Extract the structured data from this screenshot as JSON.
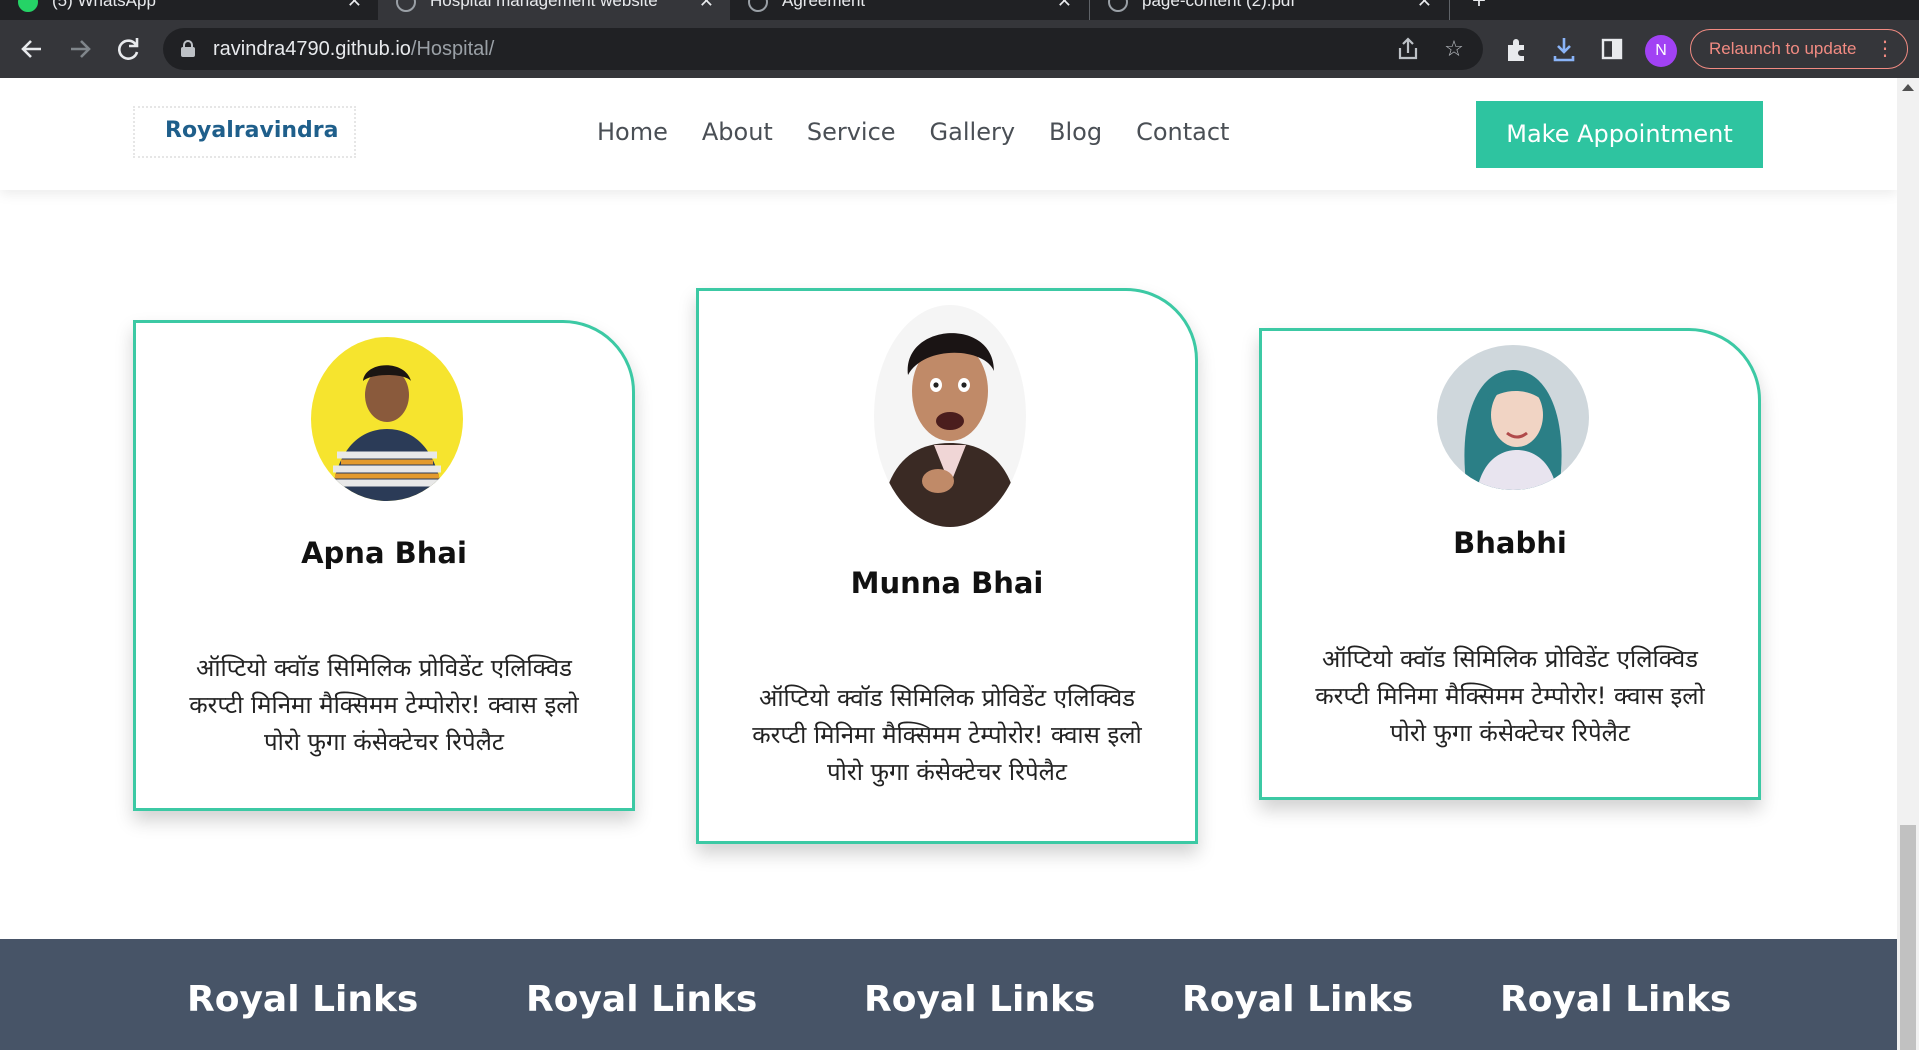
{
  "browser": {
    "tabs": [
      {
        "title": "(5) WhatsApp",
        "favicon": "whatsapp-icon"
      },
      {
        "title": "Hospital management website",
        "favicon": "globe-icon",
        "active": true
      },
      {
        "title": "Agreement",
        "favicon": "globe-icon"
      },
      {
        "title": "page-content (2).pdf",
        "favicon": "globe-icon"
      }
    ],
    "tab_close": "✕",
    "new_tab": "+",
    "url_host": "ravindra4790.github.io",
    "url_path": "/Hospital/",
    "profile_initial": "N",
    "relaunch_label": "Relaunch to update"
  },
  "site": {
    "logo": "Royalravindra",
    "nav": [
      "Home",
      "About",
      "Service",
      "Gallery",
      "Blog",
      "Contact"
    ],
    "cta": "Make Appointment"
  },
  "cards": [
    {
      "name": "Apna Bhai",
      "text": "ऑप्टियो क्वॉड सिमिलिक प्रोविडेंट एलिक्विड करप्टी मिनिमा मैक्सिमम टेम्पोरोर! क्वास इलो पोरो फुगा कंसेक्टेचर रिपेलैट"
    },
    {
      "name": "Munna Bhai",
      "text": "ऑप्टियो क्वॉड सिमिलिक प्रोविडेंट एलिक्विड करप्टी मिनिमा मैक्सिमम टेम्पोरोर! क्वास इलो पोरो फुगा कंसेक्टेचर रिपेलैट"
    },
    {
      "name": "Bhabhi",
      "text": "ऑप्टियो क्वॉड सिमिलिक प्रोविडेंट एलिक्विड करप्टी मिनिमा मैक्सिमम टेम्पोरोर! क्वास इलो पोरो फुगा कंसेक्टेचर रिपेलैट"
    }
  ],
  "footer": {
    "headings": [
      "Royal Links",
      "Royal Links",
      "Royal Links",
      "Royal Links",
      "Royal Links"
    ]
  },
  "colors": {
    "accent": "#2ec4a0",
    "card_border": "#3cc9a4",
    "footer_bg": "#475467",
    "logo": "#1f5f8b"
  }
}
